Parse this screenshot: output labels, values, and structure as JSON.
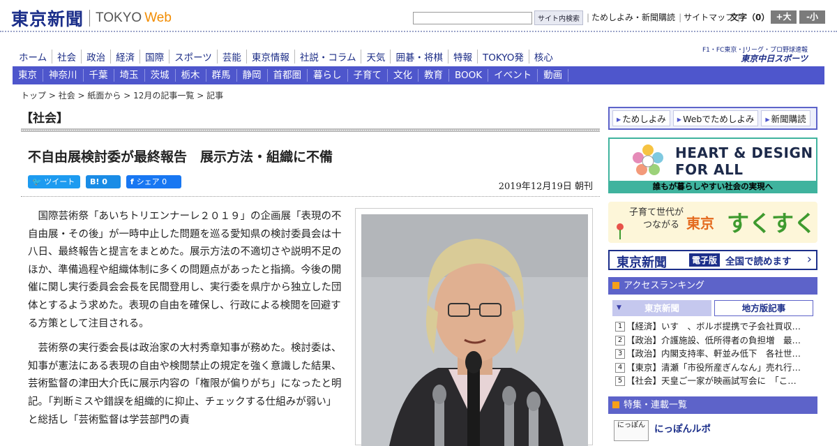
{
  "header": {
    "logo_jp": "東京新聞",
    "logo_en": "TOKYO",
    "logo_web": "Web",
    "search_button": "サイト内検索",
    "links": [
      "ためしよみ・新聞購読",
      "サイトマップ"
    ],
    "text_size_label": "文字（0）",
    "size_up": "+大",
    "size_down": "-小"
  },
  "nav_main": [
    "ホーム",
    "社会",
    "政治",
    "経済",
    "国際",
    "スポーツ",
    "芸能",
    "東京情報",
    "社説・コラム",
    "天気",
    "囲碁・将棋",
    "特報",
    "TOKYO発",
    "核心"
  ],
  "chunichi": {
    "line1": "F1・FC東京・Jリーグ・プロ野球速報",
    "line2": "東京中日スポーツ"
  },
  "nav_region": [
    "東京",
    "神奈川",
    "千葉",
    "埼玉",
    "茨城",
    "栃木",
    "群馬",
    "静岡",
    "首都圏",
    "暮らし",
    "子育て",
    "文化",
    "教育",
    "BOOK",
    "イベント",
    "動画"
  ],
  "breadcrumb": [
    "トップ",
    "社会",
    "紙面から",
    "12月の記事一覧",
    "記事"
  ],
  "section": "【社会】",
  "article": {
    "headline": "不自由展検討委が最終報告　展示方法・組織に不備",
    "tweet": "ツイート",
    "hatena": "B! 0",
    "share": "シェア 0",
    "date": "2019年12月19日 朝刊",
    "para1": "国際芸術祭「あいちトリエンナーレ２０１９」の企画展「表現の不自由展・その後」が一時中止した問題を巡る愛知県の検討委員会は十八日、最終報告と提言をまとめた。展示方法の不適切さや説明不足のほか、準備過程や組織体制に多くの問題点があったと指摘。今後の開催に関し実行委員会会長を民間登用し、実行委を県庁から独立した団体とするよう求めた。表現の自由を確保し、行政による検閲を回避する方策として注目される。",
    "para2": "芸術祭の実行委会長は政治家の大村秀章知事が務めた。検討委は、知事が憲法にある表現の自由や検閲禁止の規定を強く意識した結果、芸術監督の津田大介氏に展示内容の「権限が偏りがち」になったと明記。「判断ミスや錯誤を組織的に抑止、チェックする仕組みが弱い」と総括し「芸術監督は学芸部門の責"
  },
  "sidebar": {
    "top_buttons": [
      "ためしよみ",
      "Webでためしよみ",
      "新聞購読"
    ],
    "heart_title1": "HEART & DESIGN",
    "heart_title2": "FOR ALL",
    "heart_band": "誰もが暮らしやすい社会の実現へ",
    "suku_a1": "子育て世代が",
    "suku_a2": "つながる",
    "suku_b": "東京",
    "suku_c": "すくすく",
    "denshi_logo": "東京新聞",
    "denshi_edition": "電子版",
    "denshi_text": "全国で読めます",
    "ranking_title": "アクセスランキング",
    "ranking_tab1": "東京新聞",
    "ranking_tab2": "地方版記事",
    "ranking": [
      {
        "n": "1",
        "t": "【経済】いす　、ボルボ提携で子会社買収…"
      },
      {
        "n": "2",
        "t": "【政治】介護施設、低所得者の負担増　最…"
      },
      {
        "n": "3",
        "t": "【政治】内閣支持率、軒並み低下　各社世…"
      },
      {
        "n": "4",
        "t": "【東京】清瀬「市役所産ぎんなん」売れ行…"
      },
      {
        "n": "5",
        "t": "【社会】天皇ご一家が映画試写会に　「こ…"
      }
    ],
    "series_title": "特集・連載一覧",
    "nippon_icon": "にっぽん",
    "nippon_title": "にっぽんルポ"
  },
  "colors": {
    "brand_navy": "#1c2f8a",
    "nav_blue": "#4e56cc",
    "accent_orange": "#f28c00",
    "heart_teal": "#3fb39e"
  }
}
